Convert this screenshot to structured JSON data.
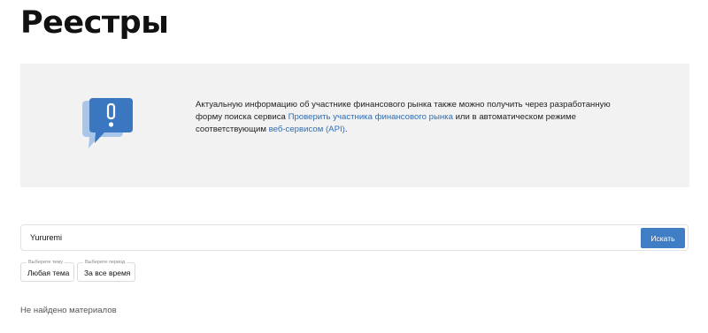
{
  "page": {
    "title": "Реестры"
  },
  "info_panel": {
    "text_before": "Актуальную информацию об участнике финансового рынка также можно получить через разработанную форму поиска сервиса ",
    "link_check": "Проверить участника финансового рынка",
    "text_middle": " или в автоматическом режиме соответствующим ",
    "link_api": "веб-сервисом (API)",
    "text_after": ".",
    "icon": "speech-bubble-exclamation-icon",
    "colors": {
      "bubble_front": "#3a77c0",
      "bubble_back": "#a9c6ea",
      "link": "#2f6db3"
    }
  },
  "search": {
    "value": "Yururemi",
    "button_label": "Искать",
    "button_color": "#3f7ec5"
  },
  "filters": [
    {
      "caption": "Выберите тему",
      "value": "Любая тема"
    },
    {
      "caption": "Выберите период",
      "value": "За все время"
    }
  ],
  "results": {
    "empty_message": "Не найдено материалов"
  }
}
